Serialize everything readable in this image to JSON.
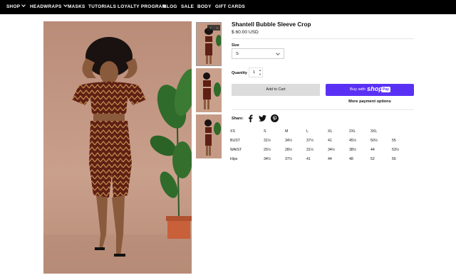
{
  "nav": {
    "items": [
      {
        "label": "SHOP",
        "dropdown": true
      },
      {
        "label": "HEADWRAPS",
        "dropdown": true
      },
      {
        "label": "MASKS",
        "dropdown": false
      },
      {
        "label": "TUTORIALS",
        "dropdown": false
      },
      {
        "label": "LOYALTY PROGRAM",
        "dropdown": false
      },
      {
        "label": "BLOG",
        "dropdown": false
      },
      {
        "label": "SALE",
        "dropdown": false
      },
      {
        "label": "BODY",
        "dropdown": false
      },
      {
        "label": "GIFT CARDS",
        "dropdown": false
      }
    ]
  },
  "product": {
    "title": "Shantell Bubble Sleeve Crop",
    "price": "$ 60.00 USD",
    "size_label": "Size",
    "size_value": "S",
    "quantity_label": "Quantity",
    "quantity_value": "1",
    "add_to_cart": "Add to Cart",
    "buy_with": "Buy with",
    "shop_word": "shop",
    "pay_badge": "Pay",
    "more_payment": "More payment options",
    "share_label": "Share:"
  },
  "gallery": {
    "thumbnails": [
      "model-front-thumb",
      "model-turn-thumb",
      "model-side-thumb"
    ],
    "colors": {
      "backdrop": "#c49a86",
      "fabric": "#6b2618",
      "skin": "#8a5a3c",
      "plant": "#2f6b2a",
      "pot": "#c8603a"
    }
  },
  "size_chart": {
    "header": [
      "XS",
      "S",
      "M",
      "L",
      "XL",
      "2XL",
      "3XL"
    ],
    "rows": [
      [
        "BUST",
        "31½",
        "34½",
        "37½",
        "41",
        "45½",
        "50½",
        "55"
      ],
      [
        "WAIST",
        "25½",
        "28½",
        "31½",
        "34½",
        "38½",
        "44",
        "53½"
      ],
      [
        "Hips",
        "34½",
        "37½",
        "41",
        "44",
        "48",
        "52",
        "56"
      ]
    ]
  },
  "colors": {
    "accent": "#5a31f4",
    "nav_bg": "#000000",
    "cart_bg": "#dcdcdc"
  }
}
